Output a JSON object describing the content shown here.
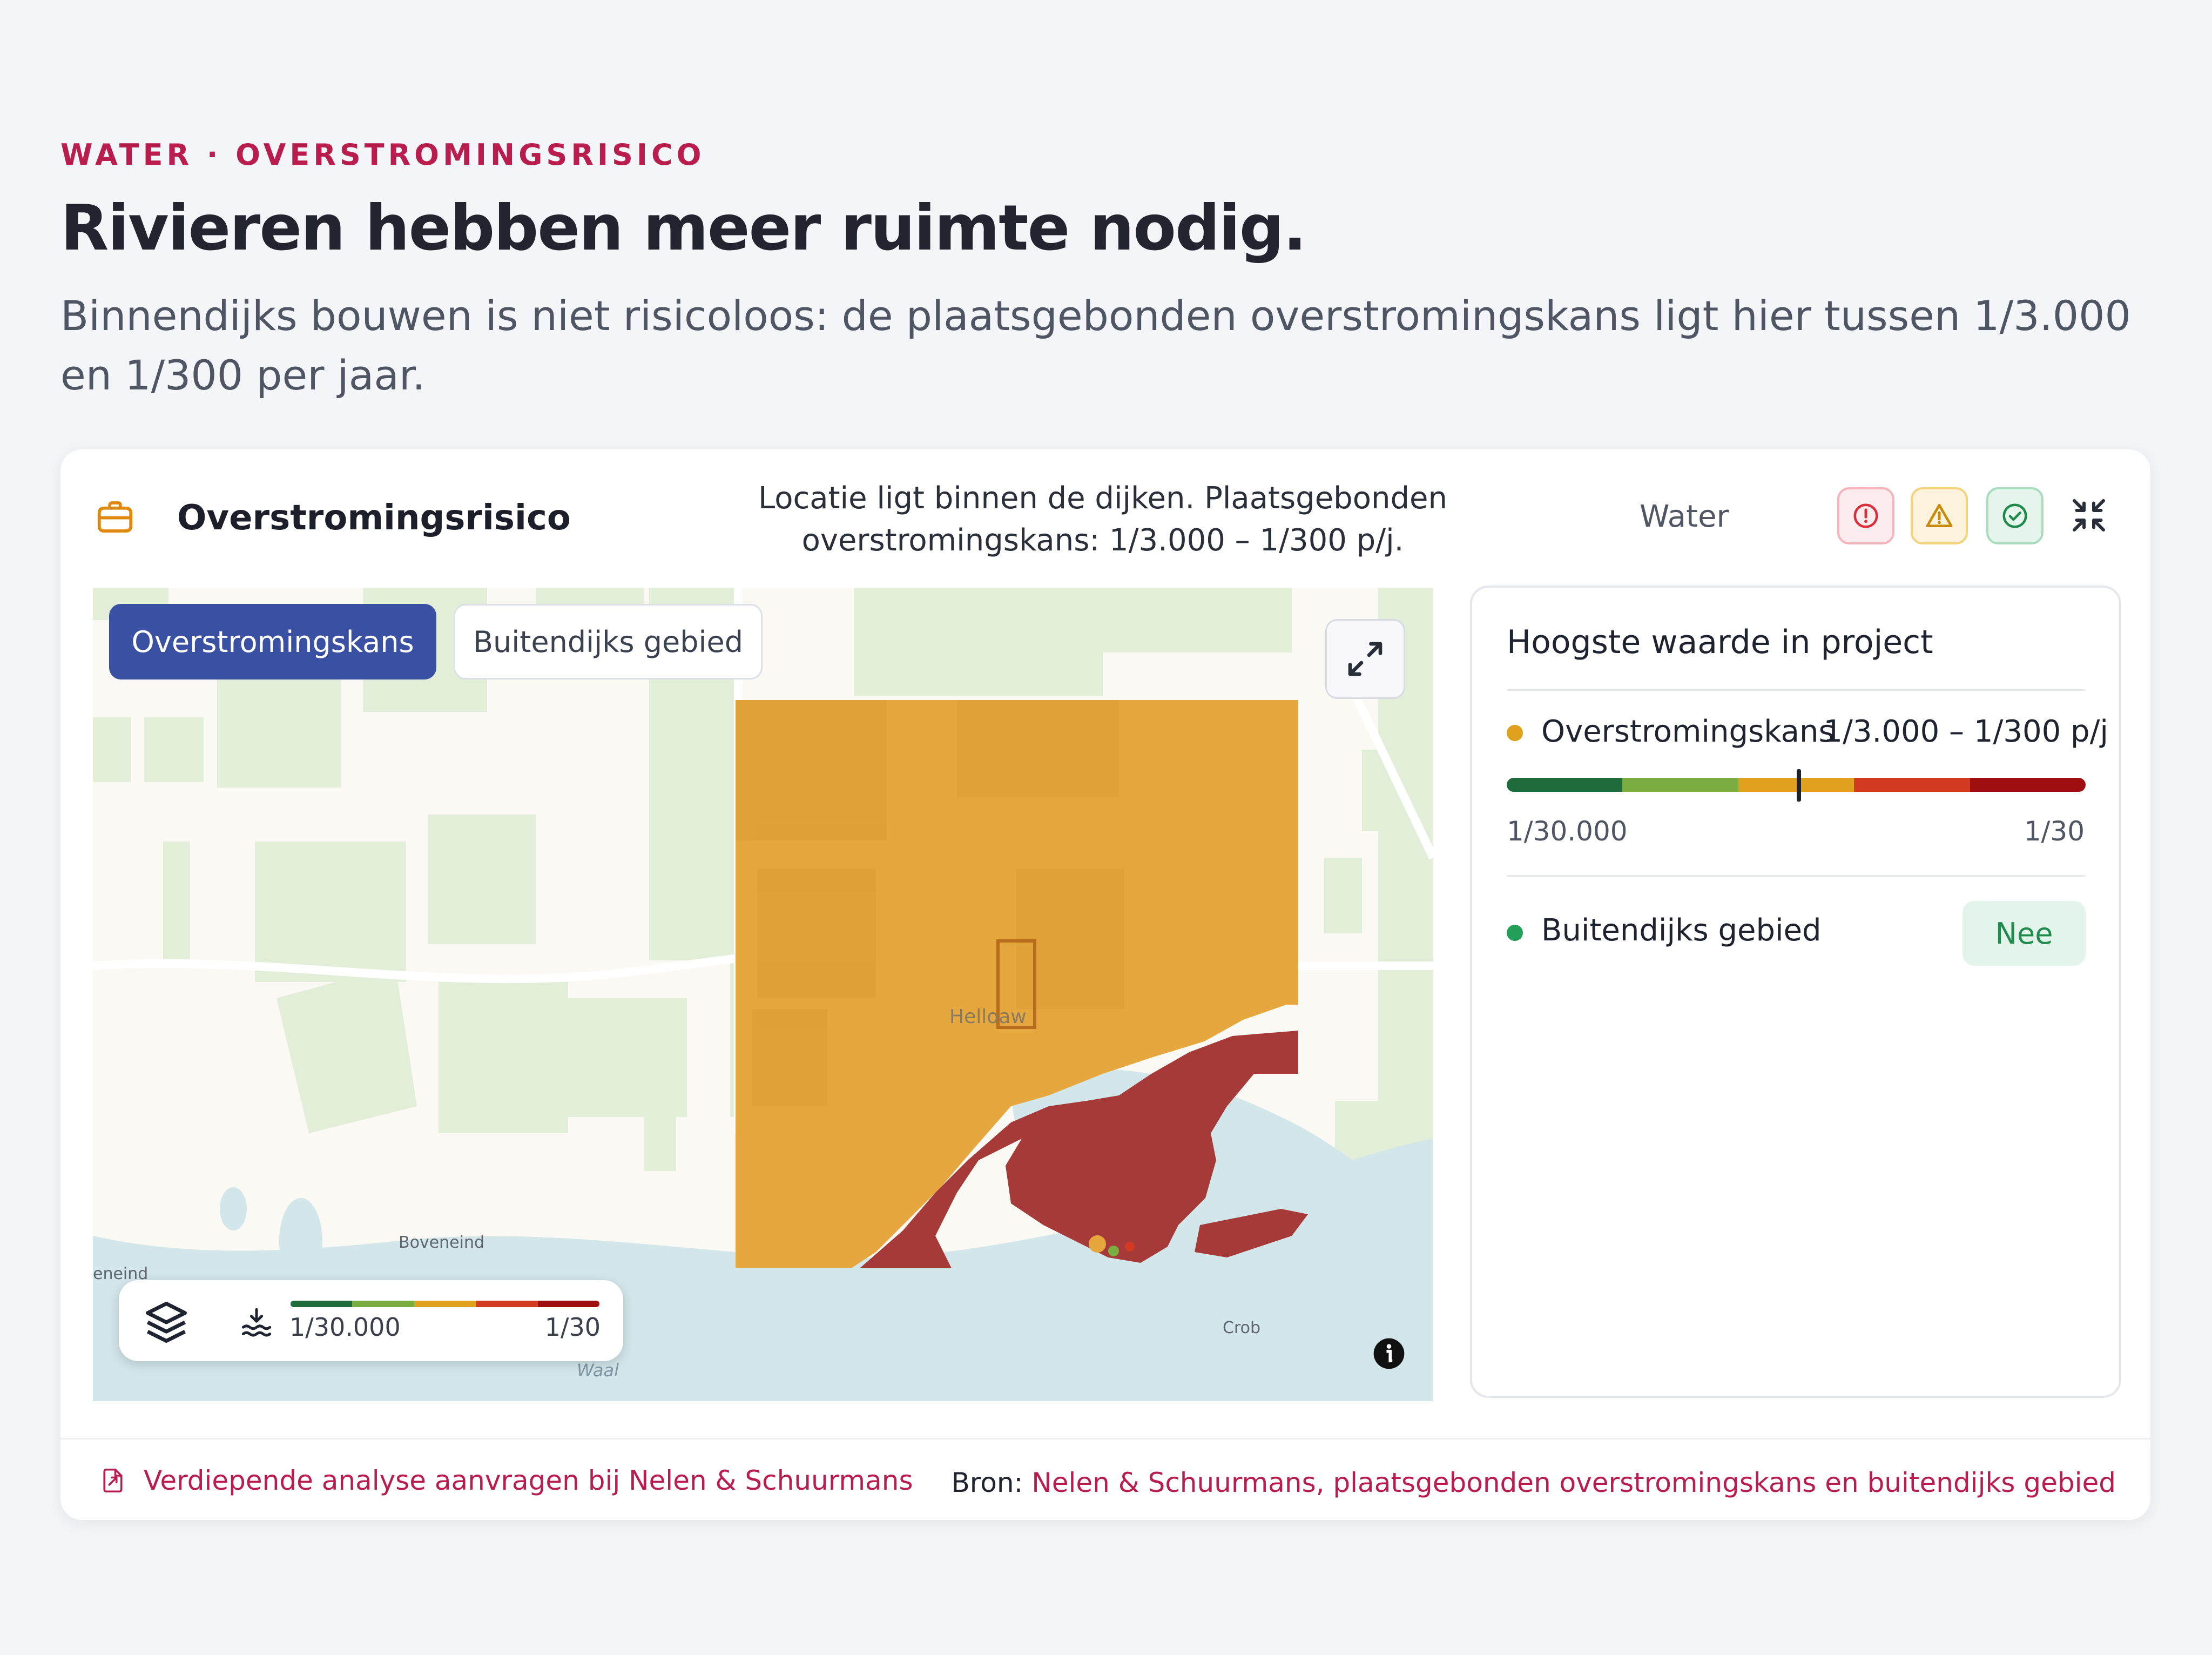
{
  "page": {
    "eyebrow": "WATER · OVERSTROMINGSRISICO",
    "headline": "Rivieren hebben meer ruimte nodig.",
    "lead": "Binnendijks bouwen is niet risicoloos: de plaatsgebonden overstromingskans ligt hier tussen 1/3.000 en 1/300 per jaar."
  },
  "card": {
    "icon": "briefcase-icon",
    "title": "Overstromingsrisico",
    "summary": "Locatie ligt binnen de dijken. Plaatsgebonden overstromingskans: 1/3.000 – 1/300 p/j.",
    "category": "Water",
    "status_buttons": [
      "error-icon",
      "warning-icon",
      "check-icon"
    ],
    "collapse_icon": "collapse-icon"
  },
  "map": {
    "tabs": [
      {
        "label": "Overstromingskans",
        "active": true
      },
      {
        "label": "Buitendijks gebied",
        "active": false
      }
    ],
    "expand_icon": "expand-icon",
    "labels": {
      "town": "Helloaw",
      "village1": "Boveneind",
      "village2": "eneind",
      "village3": "Crob",
      "river": "Waal"
    },
    "legend": {
      "layers_icon": "layers-icon",
      "water_icon": "water-level-icon",
      "low": "1/30.000",
      "high": "1/30"
    },
    "info_icon": "info-icon"
  },
  "panel": {
    "title": "Hoogste waarde in project",
    "metrics": [
      {
        "label": "Overstromingskans",
        "value": "1/3.000 – 1/300 p/j",
        "color": "#e0a21e"
      },
      {
        "label": "Buitendijks gebied",
        "value": "Nee",
        "color": "#22a05a"
      }
    ],
    "scale": {
      "low": "1/30.000",
      "high": "1/30",
      "marker_fraction": 0.505
    },
    "scale_colors": [
      "#1e6b3c",
      "#79ad3f",
      "#e0a21e",
      "#d33a22",
      "#9e0f10"
    ]
  },
  "footer": {
    "link_icon": "document-export-icon",
    "link": "Verdiepende analyse aanvragen bij Nelen & Schuurmans",
    "source_label": "Bron:",
    "source_value": "Nelen & Schuurmans, plaatsgebonden overstromingskans en buitendijks gebied"
  }
}
